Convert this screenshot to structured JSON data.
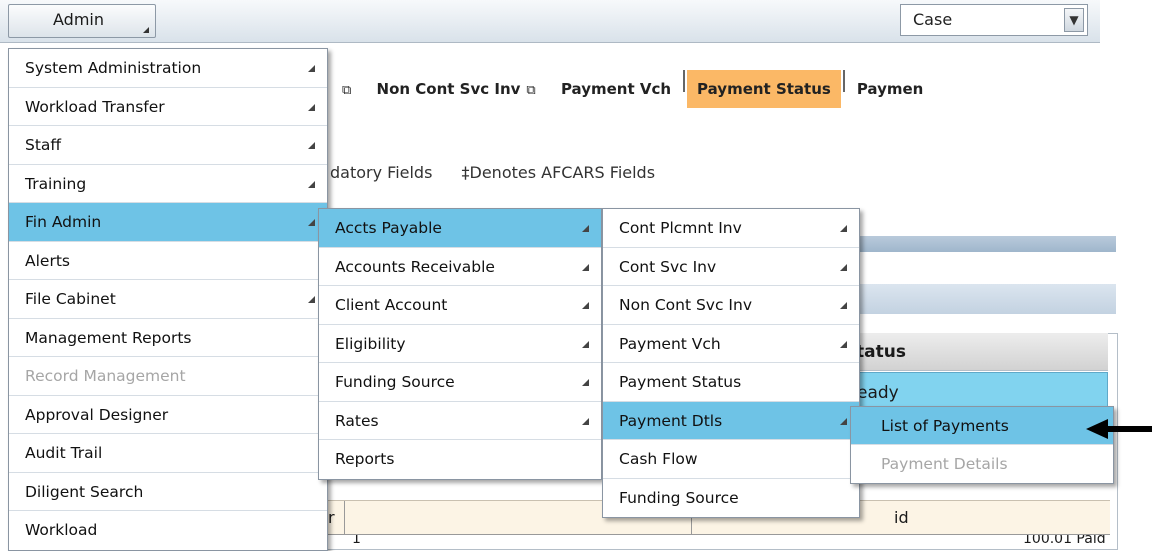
{
  "topbar": {
    "admin_label": "Admin",
    "search_type": "Case"
  },
  "tabs": [
    {
      "label": "Non Cont Svc Inv",
      "active": false
    },
    {
      "label": "Payment Vch",
      "active": false
    },
    {
      "label": "Payment Status",
      "active": true
    },
    {
      "label": "Paymen",
      "active": false
    }
  ],
  "fields_note": {
    "mandatory": "datory Fields",
    "afcars": "‡Denotes AFCARS Fields"
  },
  "background_grid": {
    "status_header": "tatus",
    "status_value": "eady",
    "row_first_cell": "r",
    "row_status": "id",
    "last_row_a": "1",
    "last_row_b": "100.01 Paid"
  },
  "admin_menu": [
    {
      "label": "System Administration",
      "submenu": true
    },
    {
      "label": "Workload Transfer",
      "submenu": true
    },
    {
      "label": "Staff",
      "submenu": true
    },
    {
      "label": "Training",
      "submenu": true
    },
    {
      "label": "Fin Admin",
      "submenu": true,
      "highlighted": true
    },
    {
      "label": "Alerts",
      "submenu": false
    },
    {
      "label": "File Cabinet",
      "submenu": true
    },
    {
      "label": "Management Reports",
      "submenu": false
    },
    {
      "label": "Record Management",
      "submenu": false,
      "disabled": true
    },
    {
      "label": "Approval Designer",
      "submenu": false
    },
    {
      "label": "Audit Trail",
      "submenu": false
    },
    {
      "label": "Diligent Search",
      "submenu": false
    },
    {
      "label": "Workload",
      "submenu": false
    }
  ],
  "fin_admin_menu": [
    {
      "label": "Accts Payable",
      "submenu": true,
      "highlighted": true
    },
    {
      "label": "Accounts Receivable",
      "submenu": true
    },
    {
      "label": "Client Account",
      "submenu": true
    },
    {
      "label": "Eligibility",
      "submenu": true
    },
    {
      "label": "Funding Source",
      "submenu": true
    },
    {
      "label": "Rates",
      "submenu": true
    },
    {
      "label": "Reports",
      "submenu": false
    }
  ],
  "accts_payable_menu": [
    {
      "label": "Cont Plcmnt Inv",
      "submenu": true
    },
    {
      "label": "Cont Svc Inv",
      "submenu": true
    },
    {
      "label": "Non Cont Svc Inv",
      "submenu": true
    },
    {
      "label": "Payment Vch",
      "submenu": true
    },
    {
      "label": "Payment Status",
      "submenu": false
    },
    {
      "label": "Payment Dtls",
      "submenu": true,
      "highlighted": true
    },
    {
      "label": "Cash Flow",
      "submenu": false
    },
    {
      "label": "Funding Source",
      "submenu": false
    }
  ],
  "payment_dtls_menu": [
    {
      "label": "List of Payments",
      "highlighted": true
    },
    {
      "label": "Payment Details",
      "disabled": true
    }
  ],
  "colors": {
    "menu_highlight": "#6ec3e6",
    "active_tab": "#fbb866",
    "disabled_text": "#a6a6a6"
  }
}
